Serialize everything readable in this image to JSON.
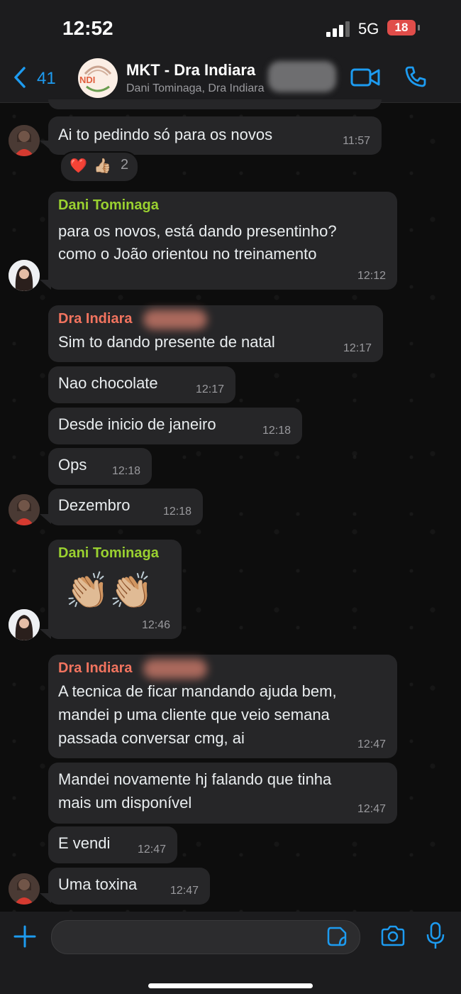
{
  "status_bar": {
    "time": "12:52",
    "network": "5G",
    "battery": "18"
  },
  "header": {
    "back_count": "41",
    "group_logo_text": "NDI",
    "title": "MKT - Dra Indiara",
    "subtitle": "Dani Tominaga, Dra Indiara"
  },
  "messages": [
    {
      "sender": "",
      "text": "Ai to pedindo só para os novos",
      "time": "11:57"
    },
    {
      "sender": "Dani Tominaga",
      "lines": [
        "para os novos, está dando presentinho?",
        "como o João orientou no treinamento"
      ],
      "time": "12:12"
    },
    {
      "sender": "Dra Indiara",
      "text": "Sim to dando presente de natal",
      "time": "12:17"
    },
    {
      "sender": "",
      "text": "Nao chocolate",
      "time": "12:17"
    },
    {
      "sender": "",
      "text": "Desde inicio de janeiro",
      "time": "12:18"
    },
    {
      "sender": "",
      "text": "Ops",
      "time": "12:18"
    },
    {
      "sender": "",
      "text": "Dezembro",
      "time": "12:18"
    },
    {
      "sender": "Dani Tominaga",
      "text": "👏🏼👏🏼",
      "time": "12:46"
    },
    {
      "sender": "Dra Indiara",
      "lines": [
        "A tecnica de ficar mandando ajuda bem,",
        "mandei p uma cliente que veio semana",
        "passada conversar cmg, ai"
      ],
      "time": "12:47"
    },
    {
      "sender": "",
      "lines": [
        "Mandei novamente hj falando que tinha",
        "mais um disponível"
      ],
      "time": "12:47"
    },
    {
      "sender": "",
      "text": "E vendi",
      "time": "12:47"
    },
    {
      "sender": "",
      "text": "Uma toxina",
      "time": "12:47"
    }
  ],
  "reaction": {
    "emojis": [
      "❤️",
      "👍🏼"
    ],
    "count": "2"
  },
  "composer": {
    "placeholder": ""
  },
  "colors": {
    "accent": "#1d9bf0",
    "dani_name": "#9ad130",
    "indiara_name": "#f2745f",
    "bubble": "#262628"
  }
}
